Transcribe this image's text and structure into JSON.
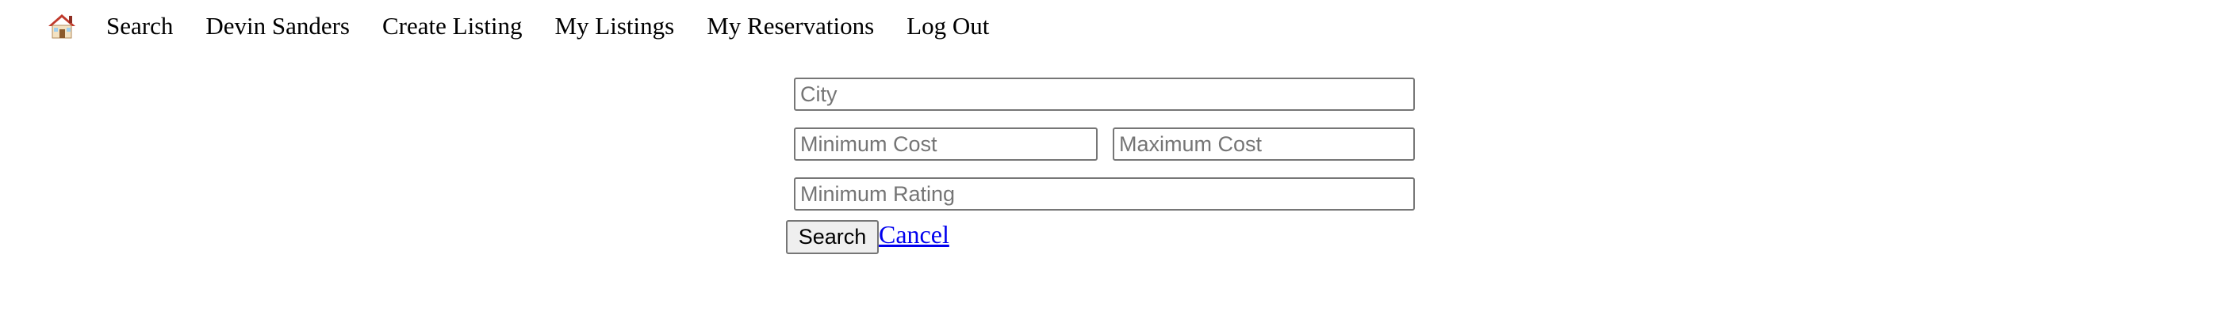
{
  "nav": {
    "home_icon": "house-icon",
    "items": [
      {
        "label": "Search"
      },
      {
        "label": "Devin Sanders"
      },
      {
        "label": "Create Listing"
      },
      {
        "label": "My Listings"
      },
      {
        "label": "My Reservations"
      },
      {
        "label": "Log Out"
      }
    ]
  },
  "search_form": {
    "city": {
      "placeholder": "City",
      "value": ""
    },
    "min_cost": {
      "placeholder": "Minimum Cost",
      "value": ""
    },
    "max_cost": {
      "placeholder": "Maximum Cost",
      "value": ""
    },
    "min_rating": {
      "placeholder": "Minimum Rating",
      "value": ""
    },
    "search_button_label": "Search",
    "cancel_link_label": "Cancel"
  },
  "colors": {
    "link": "#0000ee",
    "input_border": "#767676",
    "button_bg": "#efefef"
  }
}
